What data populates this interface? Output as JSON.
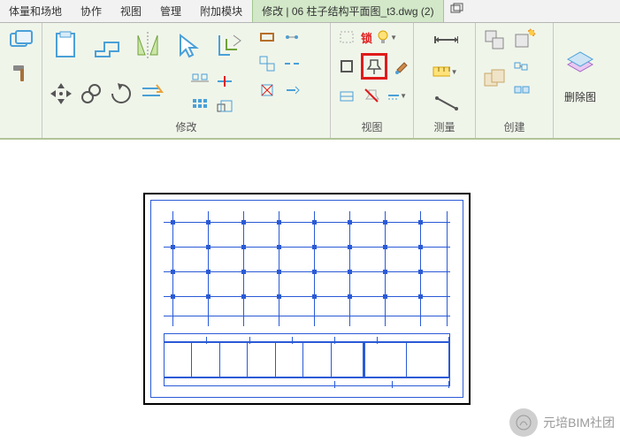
{
  "tabs": {
    "t0": "体量和场地",
    "t1": "协作",
    "t2": "视图",
    "t3": "管理",
    "t4": "附加模块",
    "t5": "修改 | 06 柱子结构平面图_t3.dwg (2)"
  },
  "ribbon": {
    "modify_title": "修改",
    "view_title": "视图",
    "measure_title": "测量",
    "create_title": "创建",
    "delete_label": "删除图",
    "lock_label": "锁"
  },
  "footer": {
    "text": "元培BIM社团"
  }
}
